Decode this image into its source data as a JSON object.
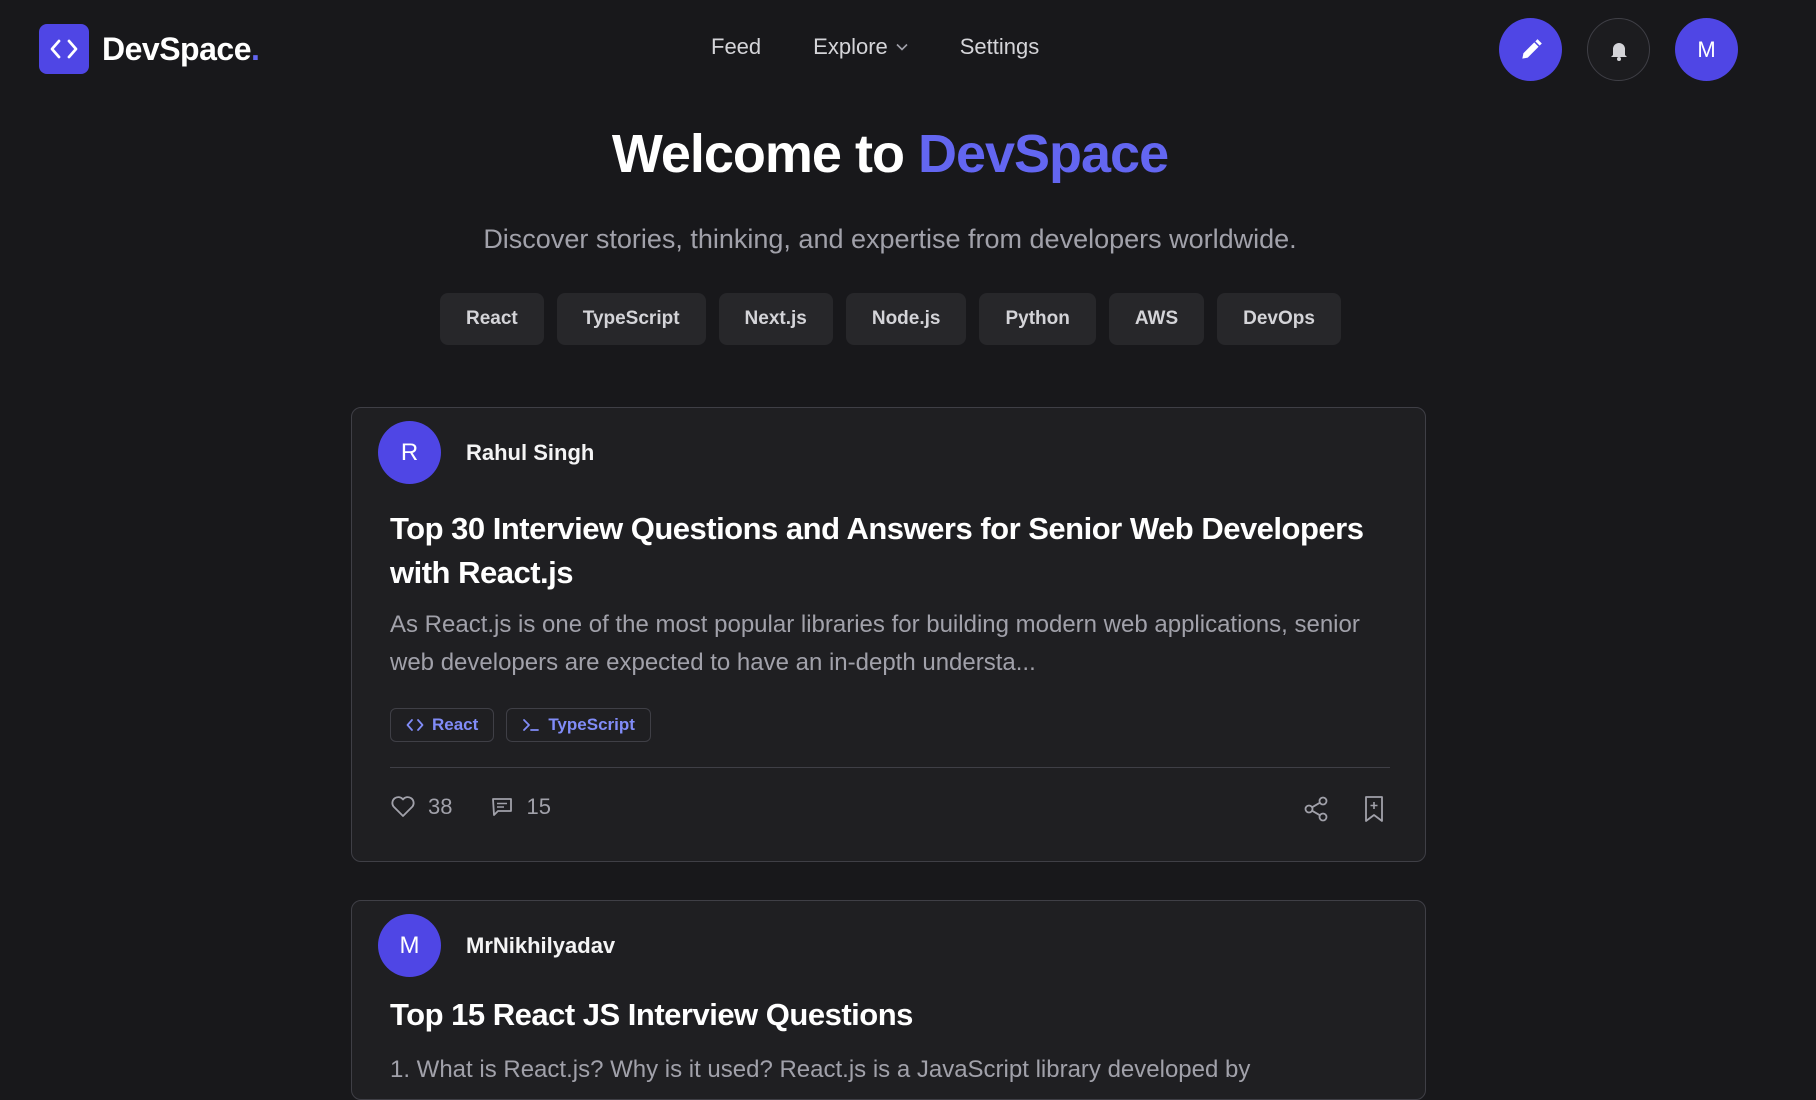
{
  "header": {
    "brand": "DevSpace",
    "brand_dot": ".",
    "nav": [
      {
        "label": "Feed"
      },
      {
        "label": "Explore"
      },
      {
        "label": "Settings"
      }
    ],
    "user_initial": "M"
  },
  "hero": {
    "title_prefix": "Welcome to ",
    "title_accent": "DevSpace",
    "subtitle": "Discover stories, thinking, and expertise from developers worldwide."
  },
  "tags": [
    "React",
    "TypeScript",
    "Next.js",
    "Node.js",
    "Python",
    "AWS",
    "DevOps"
  ],
  "posts": [
    {
      "author_initial": "R",
      "author": "Rahul Singh",
      "title": "Top 30 Interview Questions and Answers for Senior Web Developers with React.js",
      "excerpt": "As React.js is one of the most popular libraries for building modern web applications, senior web developers are expected to have an in-depth understa...",
      "tags": [
        {
          "icon": "code-icon",
          "label": "React"
        },
        {
          "icon": "terminal-icon",
          "label": "TypeScript"
        }
      ],
      "likes": "38",
      "comments": "15"
    },
    {
      "author_initial": "M",
      "author": "MrNikhilyadav",
      "title": "Top 15 React JS Interview Questions",
      "excerpt": "1. What is React.js? Why is it used? React.js is a JavaScript library developed by"
    }
  ],
  "colors": {
    "background": "#18181b",
    "card": "#1f1f22",
    "accent": "#4f46e5",
    "accent_text": "#6366f1"
  }
}
